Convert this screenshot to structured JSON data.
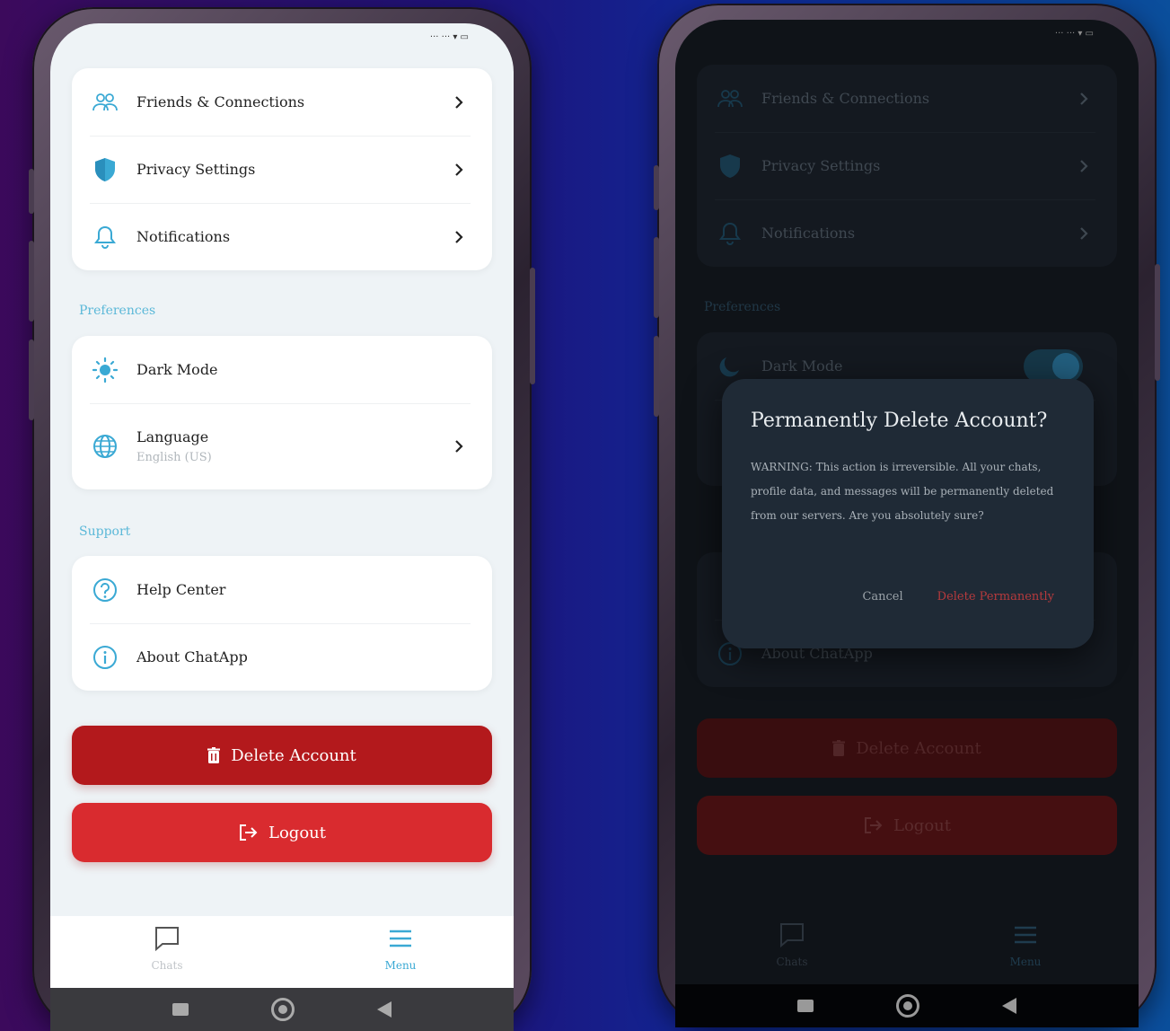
{
  "status": {
    "text": "··· ··· ▾ ▭"
  },
  "account": {
    "items": [
      {
        "label": "Friends & Connections",
        "icon": "friends-icon"
      },
      {
        "label": "Privacy Settings",
        "icon": "shield-icon"
      },
      {
        "label": "Notifications",
        "icon": "bell-icon"
      }
    ]
  },
  "preferences": {
    "heading": "Preferences",
    "dark_mode": {
      "label": "Dark Mode"
    },
    "language": {
      "label": "Language",
      "value": "English (US)"
    }
  },
  "support": {
    "heading": "Support",
    "help": {
      "label": "Help Center"
    },
    "about": {
      "label": "About ChatApp"
    }
  },
  "buttons": {
    "delete": "Delete Account",
    "logout": "Logout"
  },
  "nav": {
    "chats": "Chats",
    "menu": "Menu"
  },
  "dialog": {
    "title": "Permanently Delete Account?",
    "message": "WARNING: This action is irreversible. All your chats, profile data, and messages will be permanently deleted from our servers. Are you absolutely sure?",
    "cancel": "Cancel",
    "confirm": "Delete Permanently"
  },
  "colors": {
    "accent": "#3aa9d4",
    "danger": "#b3191c",
    "logout": "#d92b2f"
  }
}
